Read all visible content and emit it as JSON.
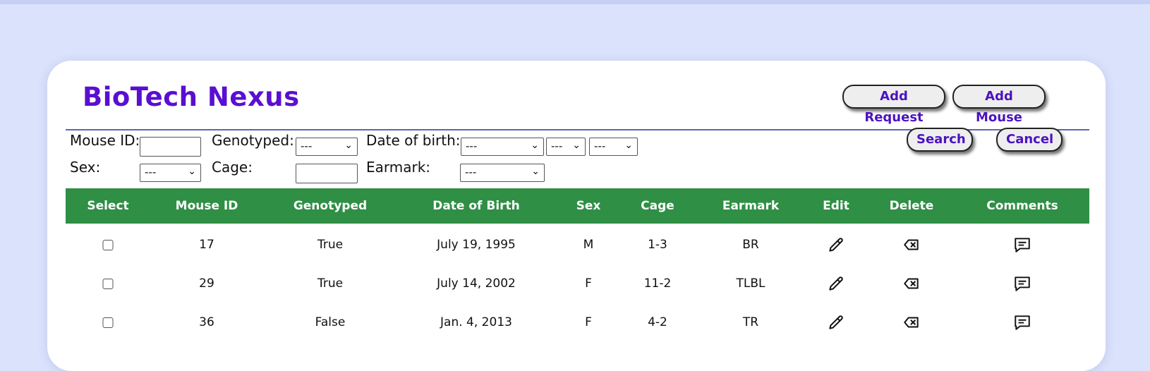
{
  "app": {
    "title": "BioTech Nexus",
    "add_request_label": "Add Request",
    "add_mouse_label": "Add Mouse"
  },
  "filters": {
    "mouse_id_label": "Mouse ID:",
    "mouse_id_value": "",
    "genotyped_label": "Genotyped:",
    "genotyped_value": "---",
    "dob_label": "Date of birth:",
    "dob_month_value": "---",
    "dob_day_value": "---",
    "dob_year_value": "---",
    "sex_label": "Sex:",
    "sex_value": "---",
    "cage_label": "Cage:",
    "cage_value": "",
    "earmark_label": "Earmark:",
    "earmark_value": "---",
    "search_label": "Search",
    "cancel_label": "Cancel"
  },
  "table": {
    "columns": [
      "Select",
      "Mouse ID",
      "Genotyped",
      "Date of Birth",
      "Sex",
      "Cage",
      "Earmark",
      "Edit",
      "Delete",
      "Comments"
    ],
    "rows": [
      {
        "mouse_id": "17",
        "genotyped": "True",
        "dob": "July 19, 1995",
        "sex": "M",
        "cage": "1-3",
        "earmark": "BR"
      },
      {
        "mouse_id": "29",
        "genotyped": "True",
        "dob": "July 14, 2002",
        "sex": "F",
        "cage": "11-2",
        "earmark": "TLBL"
      },
      {
        "mouse_id": "36",
        "genotyped": "False",
        "dob": "Jan. 4, 2013",
        "sex": "F",
        "cage": "4-2",
        "earmark": "TR"
      }
    ]
  },
  "icons": {
    "edit": "pencil-icon",
    "delete": "backspace-x-icon",
    "comments": "comment-icon"
  },
  "colors": {
    "background": "#dbe2fc",
    "brand": "#5a0fd0",
    "header_green": "#2f8f45",
    "divider": "#5b66b5"
  }
}
